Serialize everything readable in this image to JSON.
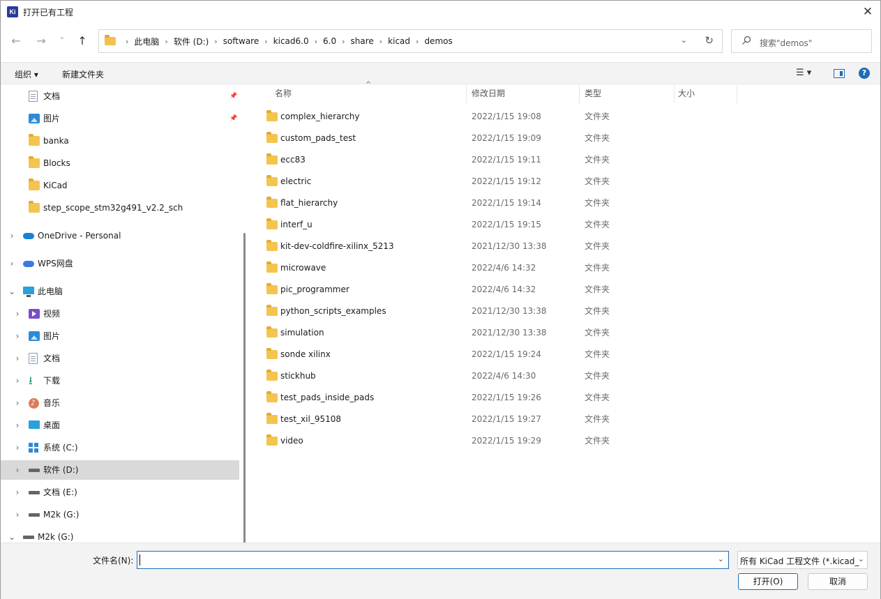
{
  "window": {
    "app_icon_text": "Ki",
    "title": "打开已有工程",
    "close_glyph": "✕"
  },
  "nav": {
    "back_glyph": "←",
    "forward_glyph": "→",
    "recent_glyph": "˅",
    "up_glyph": "↑",
    "breadcrumbs": [
      "此电脑",
      "软件 (D:)",
      "software",
      "kicad6.0",
      "6.0",
      "share",
      "kicad",
      "demos"
    ],
    "search_placeholder": "搜索\"demos\""
  },
  "toolbar": {
    "organize_label": "组织 ▾",
    "new_folder_label": "新建文件夹",
    "view_label": "☰ ▾",
    "help_label": "?"
  },
  "sidebar": {
    "items": [
      {
        "label": "文档",
        "icon": "document-icon",
        "pinned": true
      },
      {
        "label": "图片",
        "icon": "pictures-icon",
        "pinned": true
      },
      {
        "label": "banka",
        "icon": "folder-icon"
      },
      {
        "label": "Blocks",
        "icon": "folder-icon"
      },
      {
        "label": "KiCad",
        "icon": "folder-icon"
      },
      {
        "label": "step_scope_stm32g491_v2.2_sch",
        "icon": "folder-icon"
      },
      {
        "label": "OneDrive - Personal",
        "icon": "onedrive-icon"
      },
      {
        "label": "WPS网盘",
        "icon": "wps-cloud-icon"
      },
      {
        "label": "此电脑",
        "icon": "this-pc-icon"
      },
      {
        "label": "视频",
        "icon": "videos-icon"
      },
      {
        "label": "图片",
        "icon": "pictures-icon"
      },
      {
        "label": "文档",
        "icon": "document-icon"
      },
      {
        "label": "下载",
        "icon": "download-icon"
      },
      {
        "label": "音乐",
        "icon": "music-icon"
      },
      {
        "label": "桌面",
        "icon": "desktop-icon"
      },
      {
        "label": "系统 (C:)",
        "icon": "system-drive-icon"
      },
      {
        "label": "软件 (D:)",
        "icon": "drive-icon"
      },
      {
        "label": "文档 (E:)",
        "icon": "drive-icon"
      },
      {
        "label": "M2k (G:)",
        "icon": "drive-icon"
      },
      {
        "label": "M2k (G:)",
        "icon": "drive-icon"
      }
    ]
  },
  "columns": {
    "name": "名称",
    "modified": "修改日期",
    "type": "类型",
    "size": "大小"
  },
  "files": [
    {
      "name": "complex_hierarchy",
      "date": "2022/1/15 19:08",
      "type": "文件夹"
    },
    {
      "name": "custom_pads_test",
      "date": "2022/1/15 19:09",
      "type": "文件夹"
    },
    {
      "name": "ecc83",
      "date": "2022/1/15 19:11",
      "type": "文件夹"
    },
    {
      "name": "electric",
      "date": "2022/1/15 19:12",
      "type": "文件夹"
    },
    {
      "name": "flat_hierarchy",
      "date": "2022/1/15 19:14",
      "type": "文件夹"
    },
    {
      "name": "interf_u",
      "date": "2022/1/15 19:15",
      "type": "文件夹"
    },
    {
      "name": "kit-dev-coldfire-xilinx_5213",
      "date": "2021/12/30 13:38",
      "type": "文件夹"
    },
    {
      "name": "microwave",
      "date": "2022/4/6 14:32",
      "type": "文件夹"
    },
    {
      "name": "pic_programmer",
      "date": "2022/4/6 14:32",
      "type": "文件夹"
    },
    {
      "name": "python_scripts_examples",
      "date": "2021/12/30 13:38",
      "type": "文件夹"
    },
    {
      "name": "simulation",
      "date": "2021/12/30 13:38",
      "type": "文件夹"
    },
    {
      "name": "sonde xilinx",
      "date": "2022/1/15 19:24",
      "type": "文件夹"
    },
    {
      "name": "stickhub",
      "date": "2022/4/6 14:30",
      "type": "文件夹"
    },
    {
      "name": "test_pads_inside_pads",
      "date": "2022/1/15 19:26",
      "type": "文件夹"
    },
    {
      "name": "test_xil_95108",
      "date": "2022/1/15 19:27",
      "type": "文件夹"
    },
    {
      "name": "video",
      "date": "2022/1/15 19:29",
      "type": "文件夹"
    }
  ],
  "footer": {
    "filename_label": "文件名(N):",
    "filename_value": "",
    "filter_value": "所有 KiCad 工程文件 (*.kicad_",
    "open_button": "打开(O)",
    "cancel_button": "取消"
  }
}
